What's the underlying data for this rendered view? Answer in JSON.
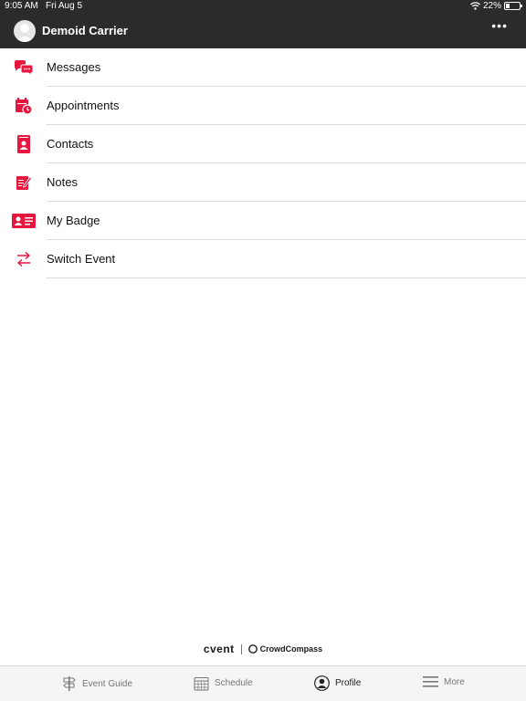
{
  "status_bar": {
    "time": "9:05 AM",
    "date": "Fri Aug 5",
    "battery": "22%",
    "icons": [
      "wifi-icon",
      "battery-charging-icon"
    ]
  },
  "header": {
    "title": "Demoid Carrier",
    "more_icon": "more-dots-icon"
  },
  "accent_color": "#e5173f",
  "menu": {
    "items": [
      {
        "label": "Messages",
        "icon": "messages-icon"
      },
      {
        "label": "Appointments",
        "icon": "appointments-icon"
      },
      {
        "label": "Contacts",
        "icon": "contacts-icon"
      },
      {
        "label": "Notes",
        "icon": "notes-icon"
      },
      {
        "label": "My Badge",
        "icon": "badge-icon"
      },
      {
        "label": "Switch Event",
        "icon": "switch-icon"
      }
    ]
  },
  "branding": {
    "cvent": "cvent",
    "crowdcompass": "CrowdCompass"
  },
  "tabbar": {
    "tabs": [
      {
        "label": "Event Guide",
        "icon": "signpost-icon",
        "active": false
      },
      {
        "label": "Schedule",
        "icon": "calendar-icon",
        "active": false
      },
      {
        "label": "Profile",
        "icon": "profile-icon",
        "active": true
      },
      {
        "label": "More",
        "icon": "hamburger-icon",
        "active": false
      }
    ]
  }
}
